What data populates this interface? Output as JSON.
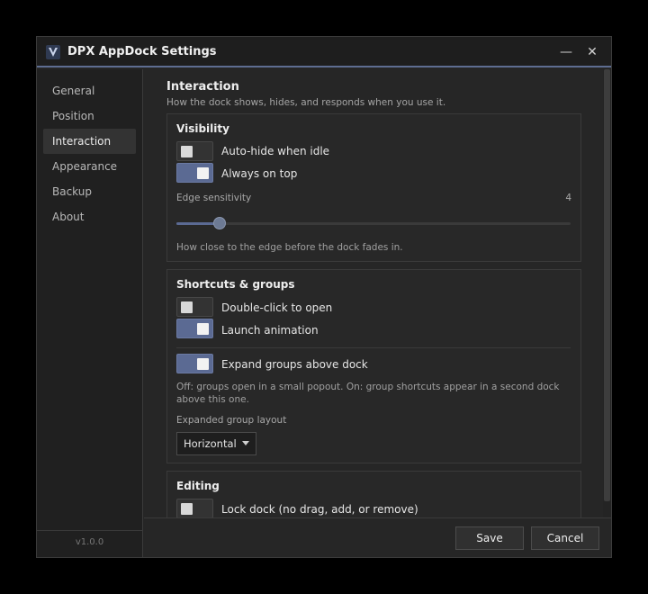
{
  "window": {
    "title": "DPX AppDock Settings",
    "minimize_glyph": "—",
    "close_glyph": "✕"
  },
  "sidebar": {
    "items": [
      {
        "label": "General"
      },
      {
        "label": "Position"
      },
      {
        "label": "Interaction"
      },
      {
        "label": "Appearance"
      },
      {
        "label": "Backup"
      },
      {
        "label": "About"
      }
    ],
    "active": "Interaction",
    "version": "v1.0.0"
  },
  "page": {
    "title": "Interaction",
    "description": "How the dock shows, hides, and responds when you use it."
  },
  "visibility": {
    "title": "Visibility",
    "auto_hide": {
      "label": "Auto-hide when idle",
      "on": false
    },
    "always_on_top": {
      "label": "Always on top",
      "on": true
    },
    "edge_sensitivity": {
      "label": "Edge sensitivity",
      "value": "4",
      "fraction": 0.11
    },
    "hint": "How close to the edge before the dock fades in."
  },
  "shortcuts": {
    "title": "Shortcuts & groups",
    "double_click": {
      "label": "Double-click to open",
      "on": false
    },
    "launch_animation": {
      "label": "Launch animation",
      "on": true
    },
    "expand_groups": {
      "label": "Expand groups above dock",
      "on": true
    },
    "hint": "Off: groups open in a small popout. On: group shortcuts appear in a second dock above this one.",
    "layout_label": "Expanded group layout",
    "layout_value": "Horizontal"
  },
  "editing": {
    "title": "Editing",
    "lock_dock": {
      "label": "Lock dock (no drag, add, or remove)",
      "on": false
    }
  },
  "footer": {
    "save_label": "Save",
    "cancel_label": "Cancel"
  },
  "colors": {
    "accent": "#5b6a93",
    "background": "#262626",
    "titlebar_border": "#5e6d91"
  }
}
